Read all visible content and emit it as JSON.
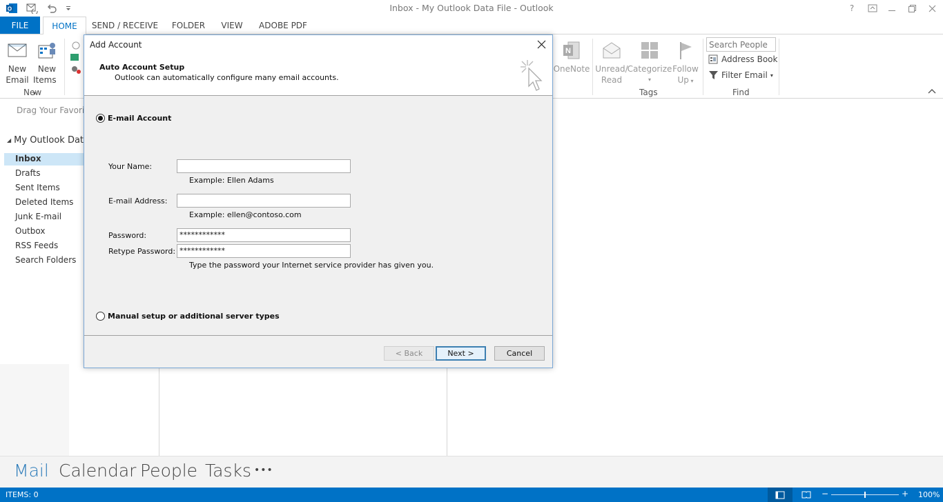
{
  "window": {
    "title": "Inbox - My Outlook Data File - Outlook"
  },
  "ribbon": {
    "tabs": [
      "FILE",
      "HOME",
      "SEND / RECEIVE",
      "FOLDER",
      "VIEW",
      "ADOBE PDF"
    ],
    "active_tab": "HOME",
    "new_group": {
      "new_email": [
        "New",
        "Email"
      ],
      "new_items": [
        "New",
        "Items"
      ],
      "label": "New"
    },
    "onenote": "OneNote",
    "tags_group": {
      "unread_read": [
        "Unread/",
        "Read"
      ],
      "categorize": "Categorize",
      "follow_up": [
        "Follow",
        "Up"
      ],
      "label": "Tags"
    },
    "find_group": {
      "search_placeholder": "Search People",
      "address_book": "Address Book",
      "filter_email": "Filter Email",
      "label": "Find"
    }
  },
  "folder_pane": {
    "favorites_hint": "Drag Your Favorite",
    "account": "My Outlook Data",
    "folders": [
      "Inbox",
      "Drafts",
      "Sent Items",
      "Deleted Items",
      "Junk E-mail",
      "Outbox",
      "RSS Feeds",
      "Search Folders"
    ],
    "selected": "Inbox"
  },
  "nav": {
    "items": [
      "Mail",
      "Calendar",
      "People",
      "Tasks"
    ],
    "active": "Mail",
    "more": "•••"
  },
  "status": {
    "items": "ITEMS: 0",
    "zoom": "100%"
  },
  "dialog": {
    "title": "Add Account",
    "heading": "Auto Account Setup",
    "subheading": "Outlook can automatically configure many email accounts.",
    "email_account_option": "E-mail Account",
    "your_name_label": "Your Name:",
    "your_name_value": "",
    "your_name_example": "Example: Ellen Adams",
    "email_label": "E-mail Address:",
    "email_value": "",
    "email_example": "Example: ellen@contoso.com",
    "password_label": "Password:",
    "password_value": "************",
    "retype_label": "Retype Password:",
    "retype_value": "************",
    "password_hint": "Type the password your Internet service provider has given you.",
    "manual_option": "Manual setup or additional server types",
    "back_button": "< Back",
    "next_button": "Next >",
    "cancel_button": "Cancel"
  }
}
